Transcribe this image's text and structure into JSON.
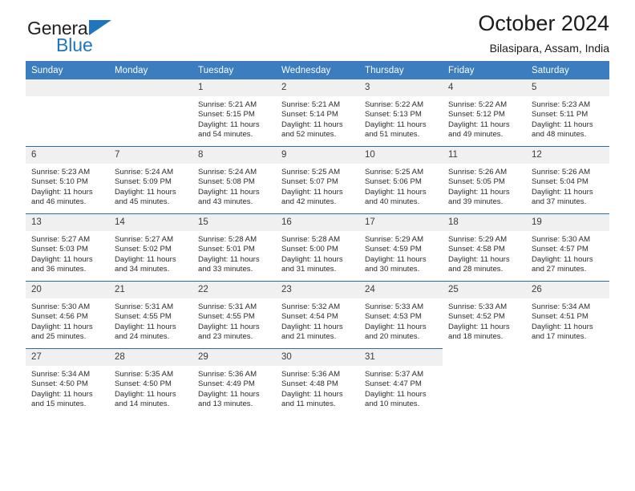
{
  "brand": {
    "name_top": "General",
    "name_bottom": "Blue",
    "accent_color": "#1f76bc"
  },
  "header": {
    "title": "October 2024",
    "subtitle": "Bilasipara, Assam, India"
  },
  "theme": {
    "header_row_bg": "#3b7dbf",
    "day_band_bg": "#f0f0f0",
    "row_separator": "#2e6da4",
    "text_color": "#2b2b2b"
  },
  "weekdays": [
    "Sunday",
    "Monday",
    "Tuesday",
    "Wednesday",
    "Thursday",
    "Friday",
    "Saturday"
  ],
  "labels": {
    "sunrise": "Sunrise:",
    "sunset": "Sunset:",
    "daylight": "Daylight:"
  },
  "weeks": [
    [
      {
        "day": "",
        "empty": true
      },
      {
        "day": "",
        "empty": true
      },
      {
        "day": "1",
        "sunrise": "Sunrise: 5:21 AM",
        "sunset": "Sunset: 5:15 PM",
        "daylight_1": "Daylight: 11 hours",
        "daylight_2": "and 54 minutes."
      },
      {
        "day": "2",
        "sunrise": "Sunrise: 5:21 AM",
        "sunset": "Sunset: 5:14 PM",
        "daylight_1": "Daylight: 11 hours",
        "daylight_2": "and 52 minutes."
      },
      {
        "day": "3",
        "sunrise": "Sunrise: 5:22 AM",
        "sunset": "Sunset: 5:13 PM",
        "daylight_1": "Daylight: 11 hours",
        "daylight_2": "and 51 minutes."
      },
      {
        "day": "4",
        "sunrise": "Sunrise: 5:22 AM",
        "sunset": "Sunset: 5:12 PM",
        "daylight_1": "Daylight: 11 hours",
        "daylight_2": "and 49 minutes."
      },
      {
        "day": "5",
        "sunrise": "Sunrise: 5:23 AM",
        "sunset": "Sunset: 5:11 PM",
        "daylight_1": "Daylight: 11 hours",
        "daylight_2": "and 48 minutes."
      }
    ],
    [
      {
        "day": "6",
        "sunrise": "Sunrise: 5:23 AM",
        "sunset": "Sunset: 5:10 PM",
        "daylight_1": "Daylight: 11 hours",
        "daylight_2": "and 46 minutes."
      },
      {
        "day": "7",
        "sunrise": "Sunrise: 5:24 AM",
        "sunset": "Sunset: 5:09 PM",
        "daylight_1": "Daylight: 11 hours",
        "daylight_2": "and 45 minutes."
      },
      {
        "day": "8",
        "sunrise": "Sunrise: 5:24 AM",
        "sunset": "Sunset: 5:08 PM",
        "daylight_1": "Daylight: 11 hours",
        "daylight_2": "and 43 minutes."
      },
      {
        "day": "9",
        "sunrise": "Sunrise: 5:25 AM",
        "sunset": "Sunset: 5:07 PM",
        "daylight_1": "Daylight: 11 hours",
        "daylight_2": "and 42 minutes."
      },
      {
        "day": "10",
        "sunrise": "Sunrise: 5:25 AM",
        "sunset": "Sunset: 5:06 PM",
        "daylight_1": "Daylight: 11 hours",
        "daylight_2": "and 40 minutes."
      },
      {
        "day": "11",
        "sunrise": "Sunrise: 5:26 AM",
        "sunset": "Sunset: 5:05 PM",
        "daylight_1": "Daylight: 11 hours",
        "daylight_2": "and 39 minutes."
      },
      {
        "day": "12",
        "sunrise": "Sunrise: 5:26 AM",
        "sunset": "Sunset: 5:04 PM",
        "daylight_1": "Daylight: 11 hours",
        "daylight_2": "and 37 minutes."
      }
    ],
    [
      {
        "day": "13",
        "sunrise": "Sunrise: 5:27 AM",
        "sunset": "Sunset: 5:03 PM",
        "daylight_1": "Daylight: 11 hours",
        "daylight_2": "and 36 minutes."
      },
      {
        "day": "14",
        "sunrise": "Sunrise: 5:27 AM",
        "sunset": "Sunset: 5:02 PM",
        "daylight_1": "Daylight: 11 hours",
        "daylight_2": "and 34 minutes."
      },
      {
        "day": "15",
        "sunrise": "Sunrise: 5:28 AM",
        "sunset": "Sunset: 5:01 PM",
        "daylight_1": "Daylight: 11 hours",
        "daylight_2": "and 33 minutes."
      },
      {
        "day": "16",
        "sunrise": "Sunrise: 5:28 AM",
        "sunset": "Sunset: 5:00 PM",
        "daylight_1": "Daylight: 11 hours",
        "daylight_2": "and 31 minutes."
      },
      {
        "day": "17",
        "sunrise": "Sunrise: 5:29 AM",
        "sunset": "Sunset: 4:59 PM",
        "daylight_1": "Daylight: 11 hours",
        "daylight_2": "and 30 minutes."
      },
      {
        "day": "18",
        "sunrise": "Sunrise: 5:29 AM",
        "sunset": "Sunset: 4:58 PM",
        "daylight_1": "Daylight: 11 hours",
        "daylight_2": "and 28 minutes."
      },
      {
        "day": "19",
        "sunrise": "Sunrise: 5:30 AM",
        "sunset": "Sunset: 4:57 PM",
        "daylight_1": "Daylight: 11 hours",
        "daylight_2": "and 27 minutes."
      }
    ],
    [
      {
        "day": "20",
        "sunrise": "Sunrise: 5:30 AM",
        "sunset": "Sunset: 4:56 PM",
        "daylight_1": "Daylight: 11 hours",
        "daylight_2": "and 25 minutes."
      },
      {
        "day": "21",
        "sunrise": "Sunrise: 5:31 AM",
        "sunset": "Sunset: 4:55 PM",
        "daylight_1": "Daylight: 11 hours",
        "daylight_2": "and 24 minutes."
      },
      {
        "day": "22",
        "sunrise": "Sunrise: 5:31 AM",
        "sunset": "Sunset: 4:55 PM",
        "daylight_1": "Daylight: 11 hours",
        "daylight_2": "and 23 minutes."
      },
      {
        "day": "23",
        "sunrise": "Sunrise: 5:32 AM",
        "sunset": "Sunset: 4:54 PM",
        "daylight_1": "Daylight: 11 hours",
        "daylight_2": "and 21 minutes."
      },
      {
        "day": "24",
        "sunrise": "Sunrise: 5:33 AM",
        "sunset": "Sunset: 4:53 PM",
        "daylight_1": "Daylight: 11 hours",
        "daylight_2": "and 20 minutes."
      },
      {
        "day": "25",
        "sunrise": "Sunrise: 5:33 AM",
        "sunset": "Sunset: 4:52 PM",
        "daylight_1": "Daylight: 11 hours",
        "daylight_2": "and 18 minutes."
      },
      {
        "day": "26",
        "sunrise": "Sunrise: 5:34 AM",
        "sunset": "Sunset: 4:51 PM",
        "daylight_1": "Daylight: 11 hours",
        "daylight_2": "and 17 minutes."
      }
    ],
    [
      {
        "day": "27",
        "sunrise": "Sunrise: 5:34 AM",
        "sunset": "Sunset: 4:50 PM",
        "daylight_1": "Daylight: 11 hours",
        "daylight_2": "and 15 minutes."
      },
      {
        "day": "28",
        "sunrise": "Sunrise: 5:35 AM",
        "sunset": "Sunset: 4:50 PM",
        "daylight_1": "Daylight: 11 hours",
        "daylight_2": "and 14 minutes."
      },
      {
        "day": "29",
        "sunrise": "Sunrise: 5:36 AM",
        "sunset": "Sunset: 4:49 PM",
        "daylight_1": "Daylight: 11 hours",
        "daylight_2": "and 13 minutes."
      },
      {
        "day": "30",
        "sunrise": "Sunrise: 5:36 AM",
        "sunset": "Sunset: 4:48 PM",
        "daylight_1": "Daylight: 11 hours",
        "daylight_2": "and 11 minutes."
      },
      {
        "day": "31",
        "sunrise": "Sunrise: 5:37 AM",
        "sunset": "Sunset: 4:47 PM",
        "daylight_1": "Daylight: 11 hours",
        "daylight_2": "and 10 minutes."
      },
      {
        "day": "",
        "empty": true,
        "trailing": true
      },
      {
        "day": "",
        "empty": true,
        "trailing": true
      }
    ]
  ]
}
